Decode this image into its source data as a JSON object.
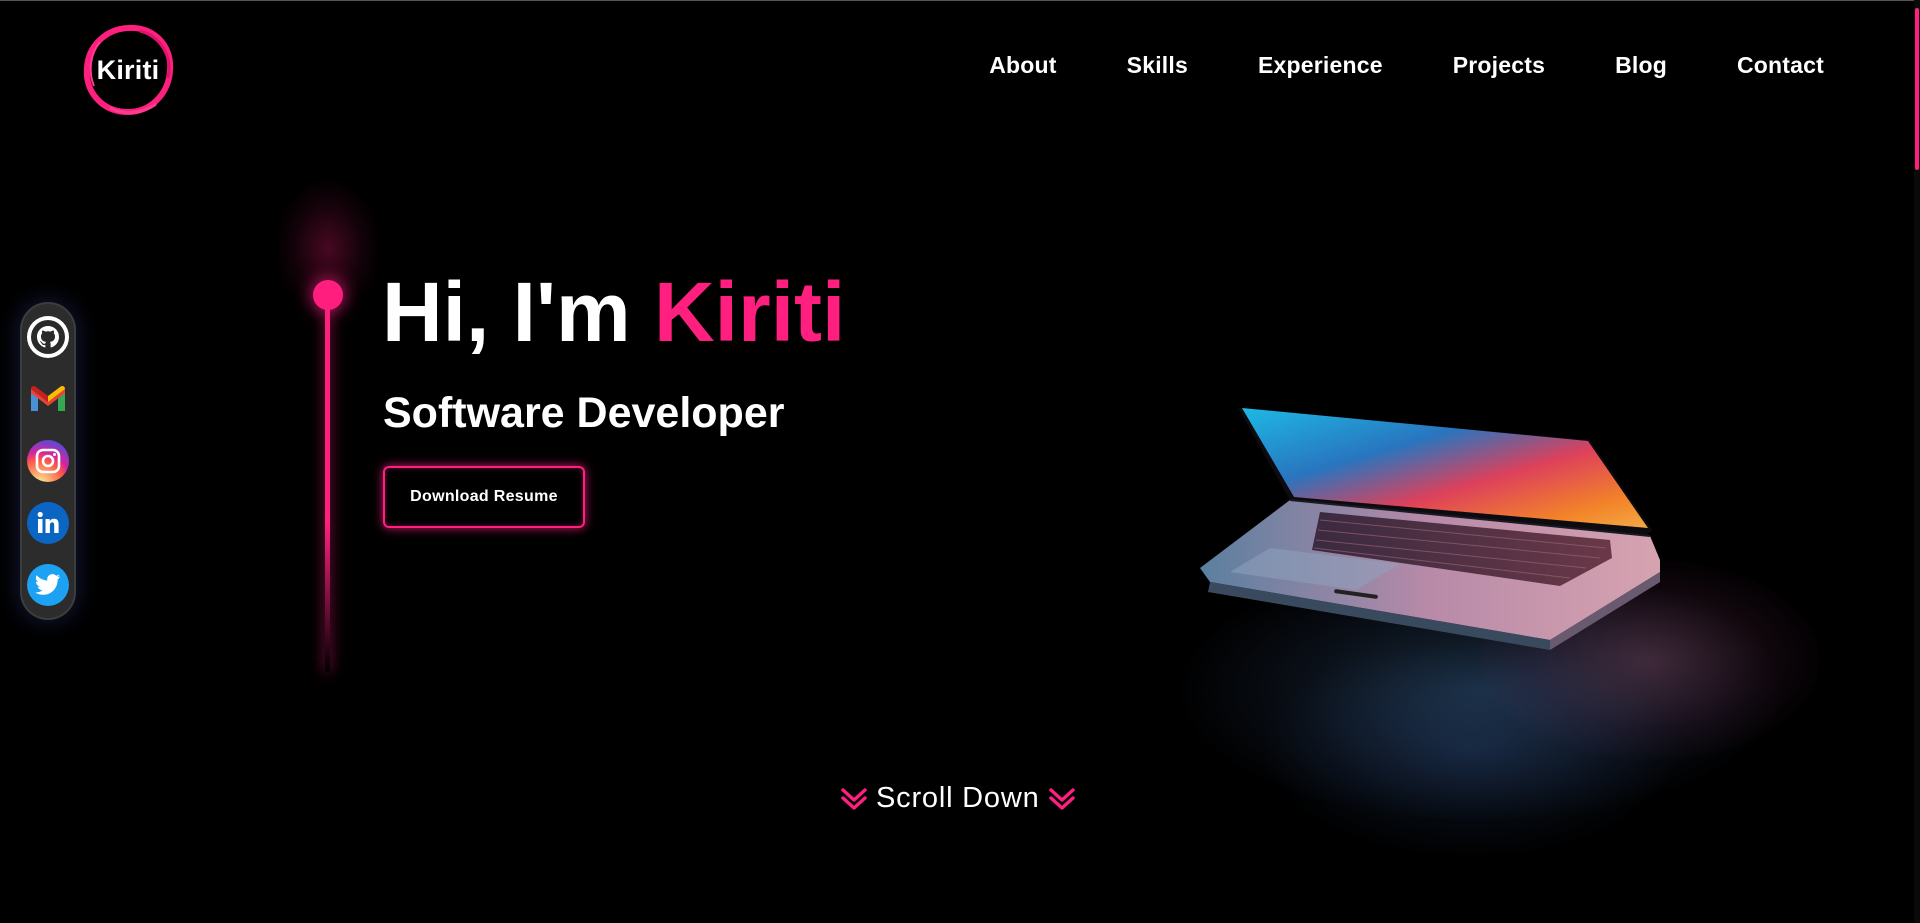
{
  "logo": {
    "text": "Kiriti"
  },
  "nav": {
    "items": [
      {
        "label": "About"
      },
      {
        "label": "Skills"
      },
      {
        "label": "Experience"
      },
      {
        "label": "Projects"
      },
      {
        "label": "Blog"
      },
      {
        "label": "Contact"
      }
    ]
  },
  "social": {
    "icons": [
      "github-icon",
      "gmail-icon",
      "instagram-icon",
      "linkedin-icon",
      "twitter-icon"
    ]
  },
  "hero": {
    "greeting": "Hi, I'm ",
    "name": "Kiriti",
    "role": "Software Developer",
    "button_label": "Download Resume"
  },
  "scroll": {
    "label": "Scroll Down"
  },
  "colors": {
    "accent": "#ff1f7f",
    "background": "#000000",
    "text": "#ffffff"
  }
}
